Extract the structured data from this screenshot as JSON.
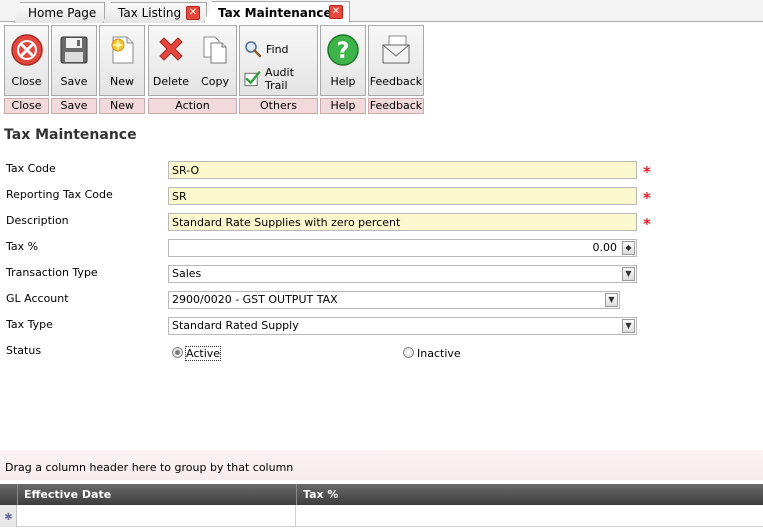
{
  "tabs": [
    {
      "label": "Home Page"
    },
    {
      "label": "Tax Listing"
    },
    {
      "label": "Tax Maintenance"
    }
  ],
  "toolbar": {
    "close": {
      "label": "Close",
      "group": "Close"
    },
    "save": {
      "label": "Save",
      "group": "Save"
    },
    "new": {
      "label": "New",
      "group": "New"
    },
    "action": {
      "delete": "Delete",
      "copy": "Copy",
      "group": "Action"
    },
    "others": {
      "find": "Find",
      "audit": "Audit Trail",
      "group": "Others"
    },
    "help": {
      "label": "Help",
      "group": "Help"
    },
    "feedback": {
      "label": "Feedback",
      "group": "Feedback"
    }
  },
  "form": {
    "title": "Tax Maintenance",
    "tax_code": {
      "label": "Tax Code",
      "value": "SR-O"
    },
    "reporting_tax_code": {
      "label": "Reporting Tax Code",
      "value": "SR"
    },
    "description": {
      "label": "Description",
      "value": "Standard Rate Supplies with zero percent"
    },
    "tax_percent": {
      "label": "Tax %",
      "value": "0.00"
    },
    "transaction_type": {
      "label": "Transaction Type",
      "value": "Sales"
    },
    "gl_account": {
      "label": "GL Account",
      "value": "2900/0020 - GST OUTPUT TAX"
    },
    "tax_type": {
      "label": "Tax Type",
      "value": "Standard Rated Supply"
    },
    "status": {
      "label": "Status",
      "active": "Active",
      "inactive": "Inactive",
      "selected": "Active"
    },
    "required_mark": "*"
  },
  "grid": {
    "group_hint": "Drag a column header here to group by that column",
    "columns": [
      "Effective Date",
      "Tax %"
    ]
  },
  "colors": {
    "required_bg": "#fbf8cd",
    "group_footer": "#f2d9db",
    "grid_header": "#3d3d3d",
    "required_star": "#e0202a"
  }
}
